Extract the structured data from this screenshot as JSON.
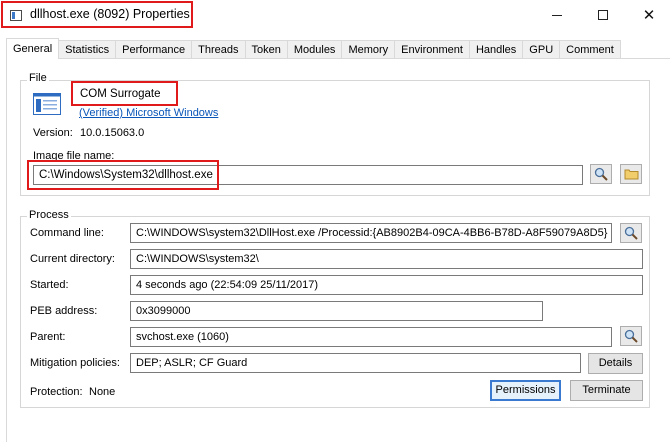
{
  "window": {
    "title": "dllhost.exe (8092) Properties",
    "controls": {
      "minimize": "",
      "maximize": "",
      "close": "✕"
    }
  },
  "tabs": [
    "General",
    "Statistics",
    "Performance",
    "Threads",
    "Token",
    "Modules",
    "Memory",
    "Environment",
    "Handles",
    "GPU",
    "Comment"
  ],
  "file": {
    "group_title": "File",
    "description": "COM Surrogate",
    "company": "(Verified) Microsoft Windows",
    "version_label": "Version:",
    "version": "10.0.15063.0",
    "image_label": "Image file name:",
    "image_path": "C:\\Windows\\System32\\dllhost.exe"
  },
  "process": {
    "group_title": "Process",
    "command_line_label": "Command line:",
    "command_line": "C:\\WINDOWS\\system32\\DllHost.exe /Processid:{AB8902B4-09CA-4BB6-B78D-A8F59079A8D5}",
    "current_dir_label": "Current directory:",
    "current_dir": "C:\\WINDOWS\\system32\\",
    "started_label": "Started:",
    "started": "4 seconds ago (22:54:09 25/11/2017)",
    "peb_label": "PEB address:",
    "peb": "0x3099000",
    "parent_label": "Parent:",
    "parent": "svchost.exe (1060)",
    "mitigation_label": "Mitigation policies:",
    "mitigation": "DEP; ASLR; CF Guard",
    "details_button": "Details",
    "protection_label": "Protection:",
    "protection": "None",
    "permissions_button": "Permissions",
    "terminate_button": "Terminate"
  },
  "colors": {
    "highlight": "#e01a1a",
    "link": "#0a56b8",
    "default_button": "#3a79d0"
  }
}
